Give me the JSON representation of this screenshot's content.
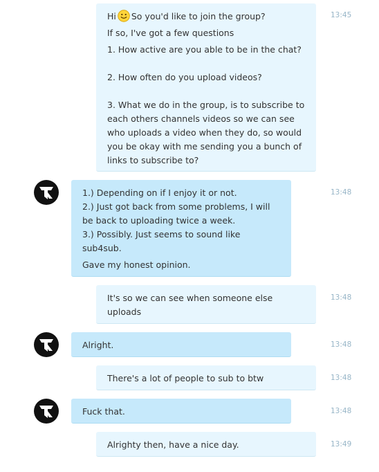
{
  "messages": [
    {
      "id": "m1",
      "direction": "outgoing",
      "time": "13:45",
      "paragraphs": [
        "So you'd like to join the group?",
        "If so, I've got a few questions",
        "1. How active are you able to be in the chat?\n\n2. How often do you upload videos?\n\n3. What we do in the group, is to subscribe to each others channels videos so we can see who uploads a video when they do, so would you be okay with me sending you a bunch of links to subscribe to?"
      ],
      "greeting": "Hi",
      "emoji": "smile-emoji"
    },
    {
      "id": "m2",
      "direction": "incoming",
      "time": "13:48",
      "paragraphs": [
        "1.) Depending on if I enjoy it or not.\n2.) Just got back from some problems, I will be back to uploading twice a week.\n3.) Possibly. Just seems to sound like sub4sub.",
        "Gave my honest opinion."
      ]
    },
    {
      "id": "m3",
      "direction": "outgoing",
      "time": "13:48",
      "paragraphs": [
        "It's so we can see when someone else uploads"
      ]
    },
    {
      "id": "m4",
      "direction": "incoming",
      "time": "13:48",
      "paragraphs": [
        "Alright."
      ]
    },
    {
      "id": "m5",
      "direction": "outgoing",
      "time": "13:48",
      "paragraphs": [
        "There's a lot of people to sub to btw"
      ]
    },
    {
      "id": "m6",
      "direction": "incoming",
      "time": "13:48",
      "paragraphs": [
        "Fuck that."
      ]
    },
    {
      "id": "m7",
      "direction": "outgoing",
      "time": "13:49",
      "paragraphs": [
        "Alrighty then, have a nice day."
      ]
    }
  ],
  "colors": {
    "outgoing_bubble": "#e7f6fe",
    "incoming_bubble": "#c6e9fb",
    "timestamp": "#97b5c7",
    "text": "#333333"
  },
  "icons": {
    "avatar": "contact-avatar-logo",
    "emoji": "smile-emoji"
  }
}
